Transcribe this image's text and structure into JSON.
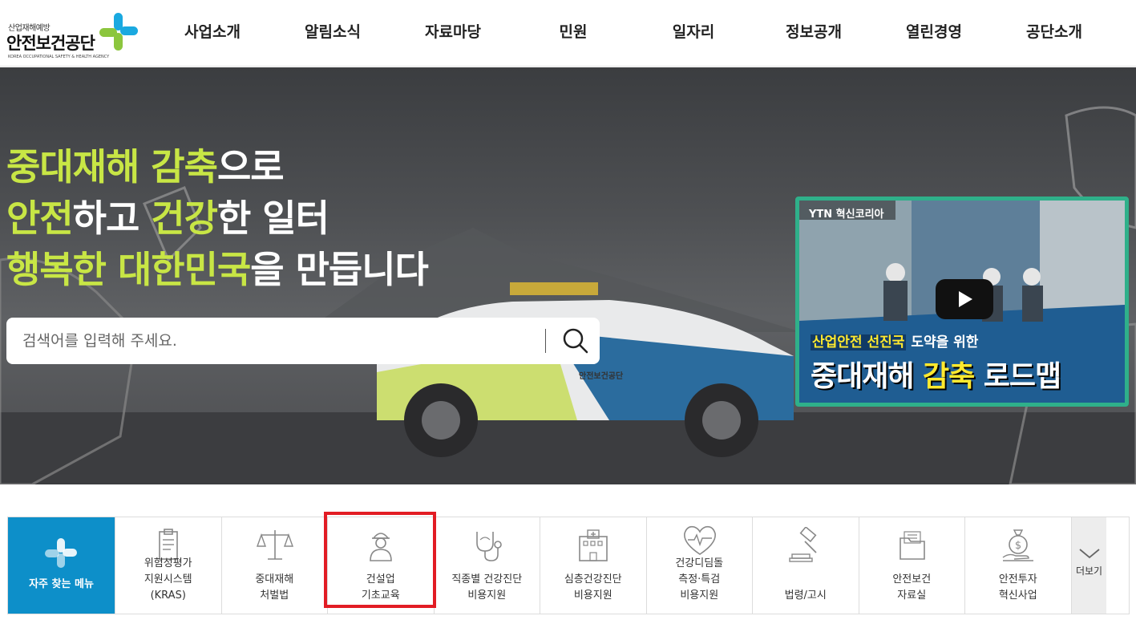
{
  "header": {
    "logo_sub": "산업재해예방",
    "logo_main": "안전보건공단",
    "logo_eng": "KOREA OCCUPATIONAL SAFETY & HEALTH AGENCY",
    "nav": [
      "사업소개",
      "알림소식",
      "자료마당",
      "민원",
      "일자리",
      "정보공개",
      "열린경영",
      "공단소개"
    ]
  },
  "hero": {
    "line1_hl": "중대재해 감축",
    "line1_rest": "으로",
    "line2_hl1": "안전",
    "line2_mid": "하고 ",
    "line2_hl2": "건강",
    "line2_rest": "한 일터",
    "line3_hl": "행복한 대한민국",
    "line3_rest": "을 만듭니다",
    "search_placeholder": "검색어를 입력해 주세요.",
    "search_icon": "search-icon"
  },
  "video": {
    "channel": "YTN 혁신코리아",
    "caption1_hl": "산업안전 선진국",
    "caption1_rest": " 도약을 위한",
    "caption2_a": "중대재해 ",
    "caption2_hl": "감축",
    "caption2_b": " 로드맵",
    "play_icon": "play-icon"
  },
  "car_label": "안전보건공단",
  "quick_menu": {
    "title": "자주 찾는 메뉴",
    "items": [
      {
        "line1": "위험성평가",
        "line2": "지원시스템",
        "line3": "(KRAS)",
        "icon": "clipboard-icon"
      },
      {
        "line1": "중대재해",
        "line2": "처벌법",
        "line3": "",
        "icon": "scale-icon"
      },
      {
        "line1": "건설업",
        "line2": "기초교육",
        "line3": "",
        "icon": "worker-icon"
      },
      {
        "line1": "직종별 건강진단",
        "line2": "비용지원",
        "line3": "",
        "icon": "stethoscope-icon"
      },
      {
        "line1": "심층건강진단",
        "line2": "비용지원",
        "line3": "",
        "icon": "hospital-icon"
      },
      {
        "line1": "건강디딤돌",
        "line2": "측정·특검",
        "line3": "비용지원",
        "icon": "heart-pulse-icon"
      },
      {
        "line1": "법령/고시",
        "line2": "",
        "line3": "",
        "icon": "gavel-icon"
      },
      {
        "line1": "안전보건",
        "line2": "자료실",
        "line3": "",
        "icon": "folder-icon"
      },
      {
        "line1": "안전투자",
        "line2": "혁신사업",
        "line3": "",
        "icon": "money-bag-icon"
      }
    ],
    "more_label": "더보기"
  },
  "colors": {
    "accent_green": "#c8e645",
    "brand_blue": "#0d8fc9",
    "highlight_red": "#e21c24",
    "video_border": "#2fb08a"
  }
}
